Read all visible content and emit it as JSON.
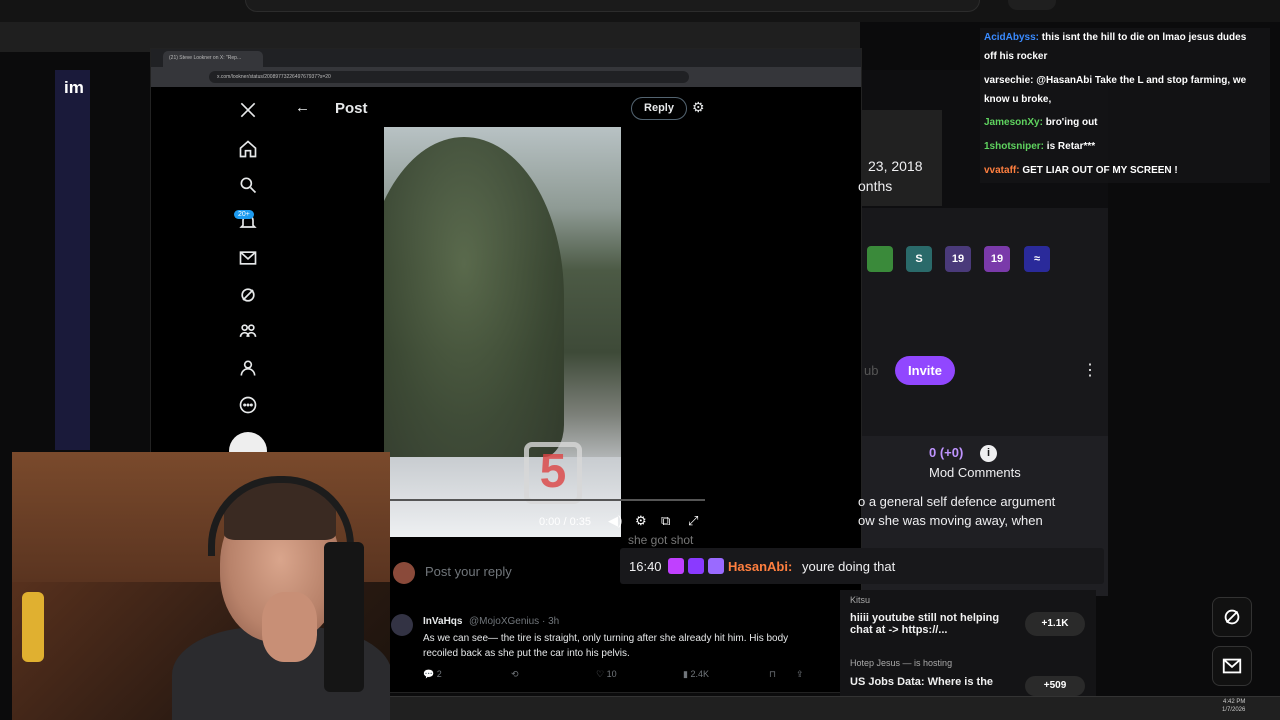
{
  "outer_browser": {
    "left_site_logo": "im"
  },
  "x_window": {
    "tab_title": "(21) Steve Lookner on X: \"Rep...",
    "url": "x.com/lookner/status/2008977322649767937?s=20",
    "post_title": "Post",
    "reply_button": "Reply",
    "notification_badge": "20+",
    "video": {
      "time": "0:00 / 0:35",
      "logo_text": "5"
    },
    "reply_placeholder": "Post your reply",
    "tweet": {
      "name": "InVaHqs",
      "handle": "@MojoXGenius · 3h",
      "text": "As we can see— the tire is straight, only turning after she already hit him. His body recoiled back as she put the car into his pelvis.",
      "replies": "2",
      "likes": "10",
      "views": "2.4K"
    }
  },
  "twitch_panel": {
    "date": "23, 2018",
    "months": "onths",
    "sub_label": "ub",
    "invite_button": "Invite",
    "mod_count": "0 (+0)",
    "mod_title": "Mod Comments",
    "mod_text_line1": "o a general self defence argument",
    "mod_text_line2": "ow she was moving away, when",
    "badges": [
      {
        "label": "",
        "color": "#3a8a3a"
      },
      {
        "label": "S",
        "color": "#2a6a6a"
      },
      {
        "label": "19",
        "color": "#4a3a7a"
      },
      {
        "label": "19",
        "color": "#7a3aaa"
      },
      {
        "label": "≈",
        "color": "#2a2a9a"
      }
    ]
  },
  "highlight_chat": {
    "partial_text": "she got shot",
    "time": "16:40",
    "user": "HasanAbi:",
    "message": "youre doing that"
  },
  "top_right_chat": [
    {
      "user": "AcidAbyss:",
      "color": "#3a8bff",
      "text": "this isnt the hill to die on lmao jesus dudes"
    },
    {
      "user": "",
      "color": "#ffffff",
      "text": "off his rocker"
    },
    {
      "user": "varsechie:",
      "color": "#ffffff",
      "text": "@HasanAbi Take the L and stop farming, we"
    },
    {
      "user": "",
      "color": "#ffffff",
      "text": "know u broke,"
    },
    {
      "user": "JamesonXy:",
      "color": "#5fd35f",
      "text": "bro'ing out"
    },
    {
      "user": "1shotsniper:",
      "color": "#5fd35f",
      "text": "is Retar***"
    },
    {
      "user": "vvataff:",
      "color": "#ff7f3f",
      "text": "GET      LIAR OUT OF MY SCREEN !"
    }
  ],
  "youtube_list": {
    "item1_channel": "Kitsu",
    "item1_title": "hiiii youtube still not helping",
    "item1_title2": "chat at -> https://...",
    "item1_badge": "+1.1K",
    "item2_channel": "Hotep Jesus",
    "item2_status": "is hosting",
    "item2_title": "US Jobs Data: Where is the",
    "item2_badge": "+509"
  },
  "taskbar": {
    "time": "4:42 PM",
    "date": "1/7/2026"
  }
}
